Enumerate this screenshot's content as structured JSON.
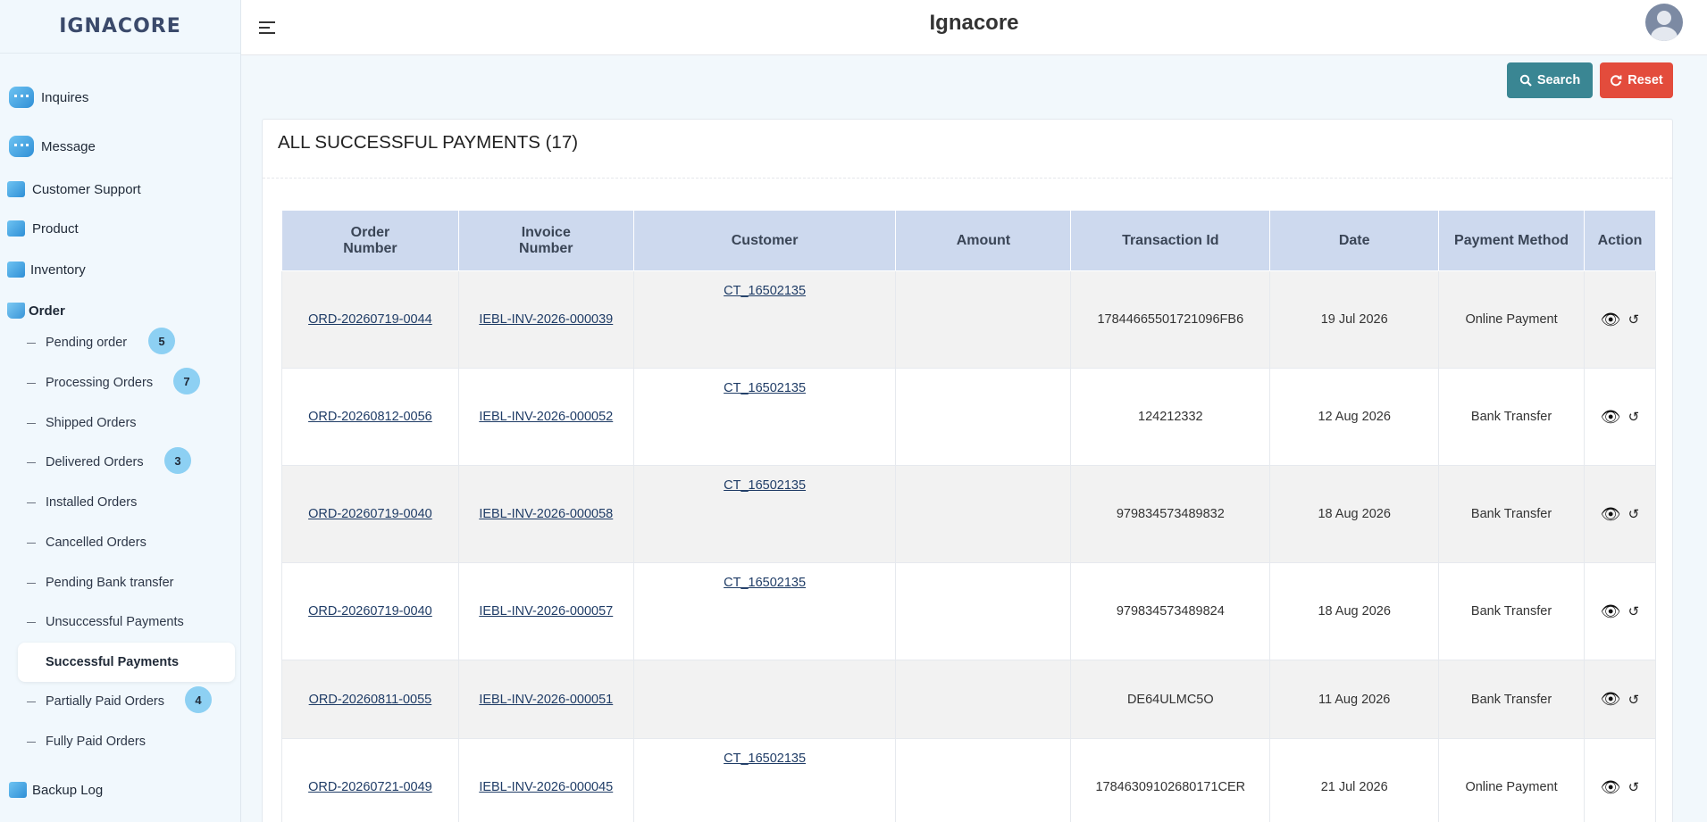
{
  "brand": "IGNACORE",
  "header": {
    "title": "Ignacore"
  },
  "sidebar": {
    "items": [
      {
        "label": "Inquires",
        "icon": "chat-icon"
      },
      {
        "label": "Message",
        "icon": "chat-icon"
      },
      {
        "label": "Customer Support",
        "icon": "support-icon"
      },
      {
        "label": "Product",
        "icon": "product-icon"
      },
      {
        "label": "Inventory",
        "icon": "inventory-icon"
      },
      {
        "label": "Order",
        "icon": "cart-icon"
      },
      {
        "label": "Backup Log",
        "icon": "backup-icon"
      }
    ],
    "order_sub": [
      {
        "label": "Pending order",
        "badge": "5"
      },
      {
        "label": "Processing Orders",
        "badge": "7"
      },
      {
        "label": "Shipped Orders"
      },
      {
        "label": "Delivered Orders",
        "badge": "3"
      },
      {
        "label": "Installed Orders"
      },
      {
        "label": "Cancelled Orders"
      },
      {
        "label": "Pending Bank transfer"
      },
      {
        "label": "Unsuccessful Payments"
      },
      {
        "label": "Successful Payments"
      },
      {
        "label": "Partially Paid Orders",
        "badge": "4"
      },
      {
        "label": "Fully Paid Orders"
      }
    ]
  },
  "toolbar": {
    "search_label": "Search",
    "reset_label": "Reset"
  },
  "card": {
    "title": "ALL SUCCESSFUL PAYMENTS (17)"
  },
  "table": {
    "headers": {
      "order_line1": "Order",
      "order_line2": "Number",
      "invoice_line1": "Invoice",
      "invoice_line2": "Number",
      "customer": "Customer",
      "amount": "Amount",
      "transaction": "Transaction Id",
      "date": "Date",
      "method": "Payment Method",
      "action": "Action"
    },
    "rows": [
      {
        "order": "ORD-20260719-0044",
        "invoice": "IEBL-INV-2026-000039",
        "customer": "CT_16502135",
        "amount": "",
        "txn": "17844665501721096FB6",
        "date": "19 Jul 2026",
        "method": "Online Payment"
      },
      {
        "order": "ORD-20260812-0056",
        "invoice": "IEBL-INV-2026-000052",
        "customer": "CT_16502135",
        "amount": "",
        "txn": "124212332",
        "date": "12 Aug 2026",
        "method": "Bank Transfer"
      },
      {
        "order": "ORD-20260719-0040",
        "invoice": "IEBL-INV-2026-000058",
        "customer": "CT_16502135",
        "amount": "",
        "txn": "979834573489832",
        "date": "18 Aug 2026",
        "method": "Bank Transfer"
      },
      {
        "order": "ORD-20260719-0040",
        "invoice": "IEBL-INV-2026-000057",
        "customer": "CT_16502135",
        "amount": "",
        "txn": "979834573489824",
        "date": "18 Aug 2026",
        "method": "Bank Transfer"
      },
      {
        "order": "ORD-20260811-0055",
        "invoice": "IEBL-INV-2026-000051",
        "customer": "",
        "amount": "",
        "txn": "DE64ULMC5O",
        "date": "11 Aug 2026",
        "method": "Bank Transfer"
      },
      {
        "order": "ORD-20260721-0049",
        "invoice": "IEBL-INV-2026-000045",
        "customer": "CT_16502135",
        "amount": "",
        "txn": "17846309102680171CER",
        "date": "21 Jul 2026",
        "method": "Online Payment"
      }
    ]
  }
}
